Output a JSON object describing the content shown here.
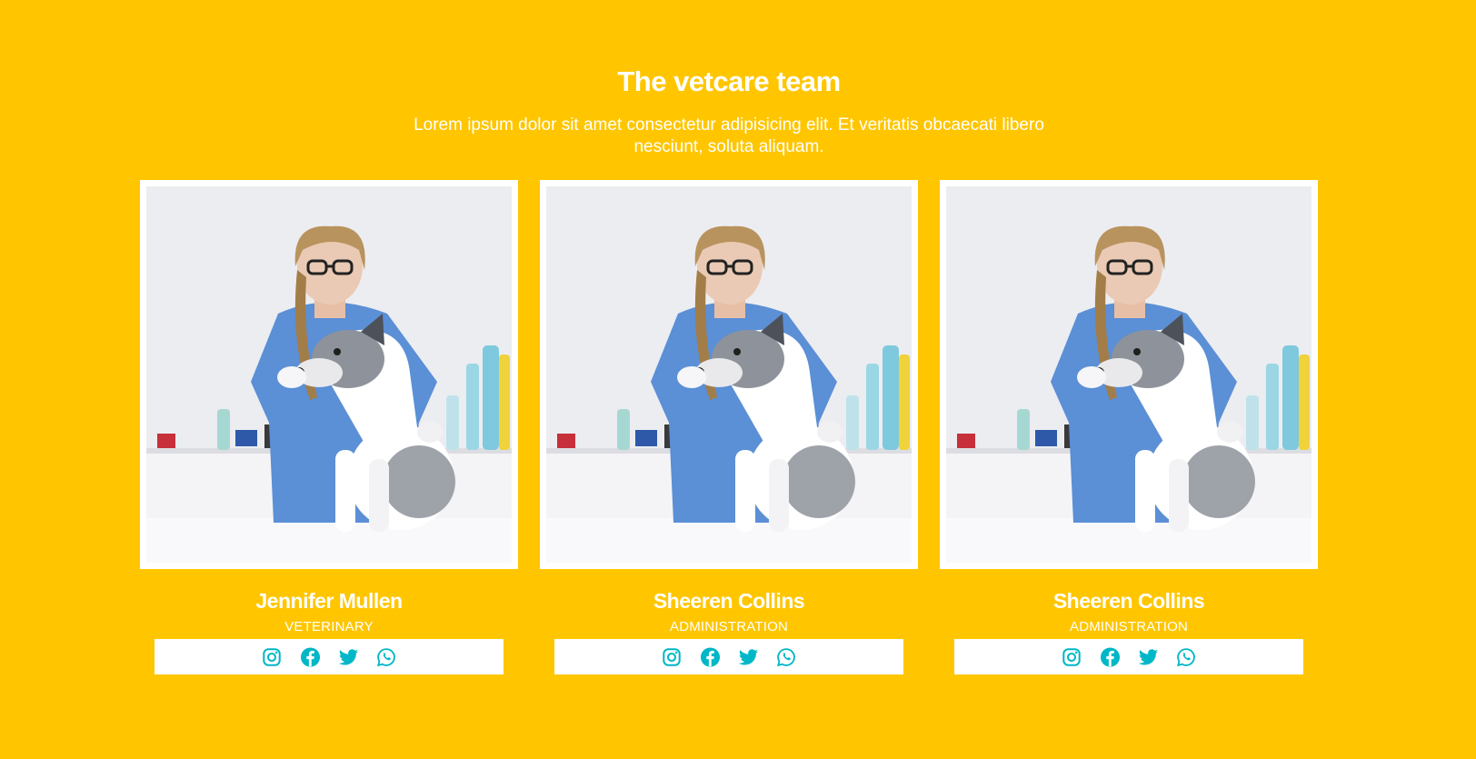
{
  "header": {
    "title": "The vetcare team",
    "subtitle": "Lorem ipsum dolor sit amet consectetur adipisicing elit. Et veritatis obcaecati libero nesciunt, soluta aliquam."
  },
  "team": [
    {
      "name": "Jennifer Mullen",
      "role": "VETERINARY"
    },
    {
      "name": "Sheeren Collins",
      "role": "ADMINISTRATION"
    },
    {
      "name": "Sheeren Collins",
      "role": "ADMINISTRATION"
    }
  ],
  "social_icons": [
    "instagram-icon",
    "facebook-icon",
    "twitter-icon",
    "whatsapp-icon"
  ],
  "colors": {
    "background": "#FFC600",
    "card": "#FFFFFF",
    "icon": "#00B7C7",
    "text": "#FFFFFF"
  }
}
